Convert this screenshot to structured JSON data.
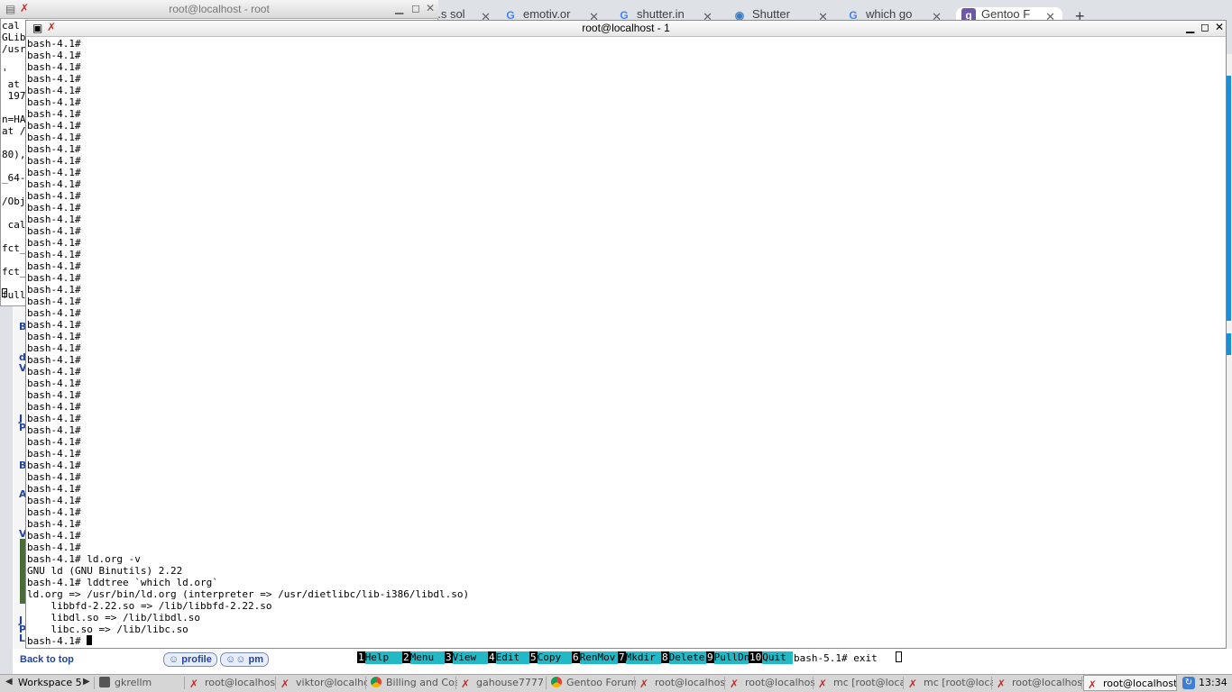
{
  "browser": {
    "tabs": [
      {
        "label": "...s sol",
        "icon": "google-icon"
      },
      {
        "label": "emotiv.or",
        "icon": "google-icon"
      },
      {
        "label": "shutter.in",
        "icon": "google-icon"
      },
      {
        "label": "Shutter",
        "icon": "shutter-icon"
      },
      {
        "label": "which go",
        "icon": "google-icon"
      },
      {
        "label": "Gentoo F",
        "icon": "gentoo-icon",
        "active": true
      }
    ],
    "new_tab": "+",
    "page": {
      "left_fragments": [
        "B",
        "d",
        "V",
        "J",
        "P",
        "B",
        "A",
        "V",
        "J",
        "P",
        "L"
      ],
      "back_to_top": "Back to top",
      "bookmarks": [
        "profile",
        "pm"
      ]
    }
  },
  "xterm_back": {
    "title": "root@localhost - root",
    "lines": [
      "cal",
      "GLib",
      "/usr",
      "",
      "' ",
      " at ",
      " 197",
      "",
      "n=HA",
      "at /",
      "",
      "80),",
      "",
      "_64-",
      "",
      "/Obj",
      "",
      " cal",
      "",
      "fct_",
      "",
      "fct_",
      "",
      "full"
    ]
  },
  "xterm_front": {
    "title": "root@localhost - 1",
    "prompt": "bash-4.1#",
    "empty_prompt_count": 44,
    "output": [
      "bash-4.1# ld.org -v",
      "GNU ld (GNU Binutils) 2.22",
      "bash-4.1# lddtree `which ld.org`",
      "ld.org => /usr/bin/ld.org (interpreter => /usr/dietlibc/lib-i386/libdl.so)",
      "    libbfd-2.22.so => /lib/libbfd-2.22.so",
      "    libdl.so => /lib/libdl.so",
      "    libc.so => /lib/libc.so"
    ],
    "last_prompt": "bash-4.1#"
  },
  "mc": {
    "keys": [
      {
        "n": "1",
        "label": "Help"
      },
      {
        "n": "2",
        "label": "Menu"
      },
      {
        "n": "3",
        "label": "View"
      },
      {
        "n": "4",
        "label": "Edit"
      },
      {
        "n": "5",
        "label": "Copy"
      },
      {
        "n": "6",
        "label": "RenMov"
      },
      {
        "n": "7",
        "label": "Mkdir"
      },
      {
        "n": "8",
        "label": "Delete"
      },
      {
        "n": "9",
        "label": "PullDn"
      },
      {
        "n": "10",
        "label": "Quit"
      }
    ],
    "cmdline": "bash-5.1# exit"
  },
  "taskbar": {
    "workspace": "Workspace 5",
    "items": [
      {
        "label": "gkrellm",
        "icon": "gkrellm-icon"
      },
      {
        "label": "root@localhost",
        "icon": "xterm-icon"
      },
      {
        "label": "viktor@localho",
        "icon": "xterm-icon"
      },
      {
        "label": "Billing and Cost",
        "icon": "chrome-icon"
      },
      {
        "label": "gahouse7777",
        "icon": "xterm-icon"
      },
      {
        "label": "Gentoo Forum",
        "icon": "chrome-icon"
      },
      {
        "label": "root@localhost",
        "icon": "xterm-icon"
      },
      {
        "label": "root@localhost",
        "icon": "xterm-icon"
      },
      {
        "label": "mc [root@local",
        "icon": "xterm-icon"
      },
      {
        "label": "mc [root@local",
        "icon": "xterm-icon"
      },
      {
        "label": "root@localhost",
        "icon": "xterm-icon"
      },
      {
        "label": "root@localhost",
        "icon": "xterm-icon",
        "active": true
      }
    ],
    "clock": "13:34"
  }
}
